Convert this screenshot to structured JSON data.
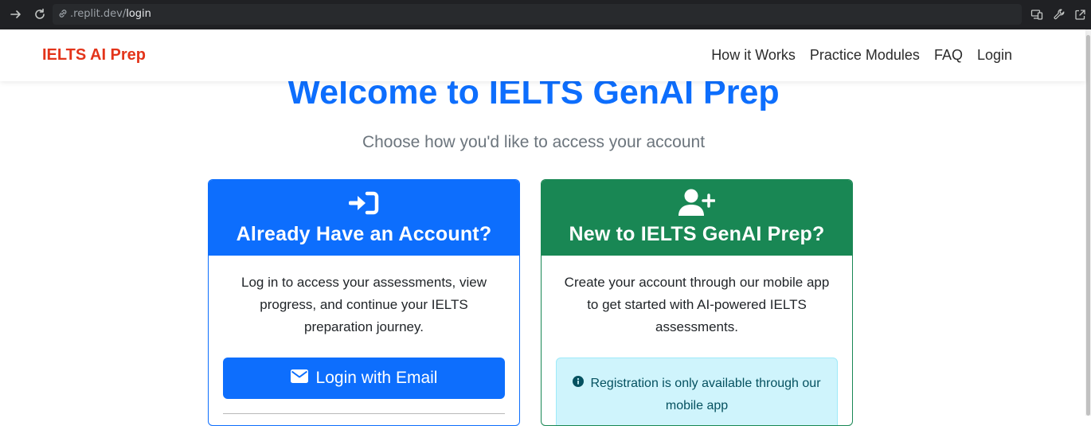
{
  "browser": {
    "url_domain": ".replit.dev/",
    "url_path": "login",
    "icons": [
      "forward-icon",
      "reload-icon",
      "link-icon",
      "devices-icon",
      "wrench-icon",
      "open-external-icon"
    ]
  },
  "navbar": {
    "brand": "IELTS AI Prep",
    "links": [
      "How it Works",
      "Practice Modules",
      "FAQ",
      "Login"
    ]
  },
  "hero": {
    "title": "Welcome to IELTS GenAI Prep",
    "subtitle": "Choose how you'd like to access your account"
  },
  "login_card": {
    "icon": "sign-in-icon",
    "title": "Already Have an Account?",
    "text": "Log in to access your assessments, view progress, and continue your IELTS preparation journey.",
    "button_icon": "envelope-icon",
    "button_label": "Login with Email"
  },
  "register_card": {
    "icon": "user-plus-icon",
    "title": "New to IELTS GenAI Prep?",
    "text": "Create your account through our mobile app to get started with AI-powered IELTS assessments.",
    "alert_icon": "info-circle-icon",
    "alert_text": "Registration is only available through our mobile app"
  },
  "colors": {
    "primary": "#0d6efd",
    "success": "#198754",
    "brand": "#e3341a",
    "info_bg": "#cff4fc",
    "info_text": "#055160"
  }
}
